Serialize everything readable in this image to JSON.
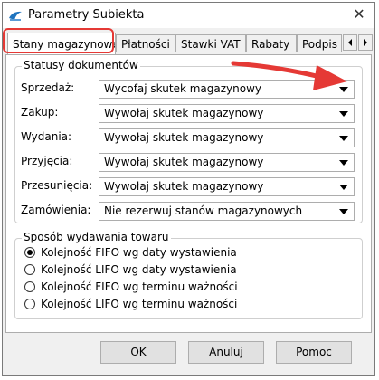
{
  "window": {
    "title": "Parametry Subiekta",
    "close_glyph": "✕"
  },
  "tabs": [
    {
      "label": "Stany magazynowe",
      "active": true
    },
    {
      "label": "Płatności"
    },
    {
      "label": "Stawki VAT"
    },
    {
      "label": "Rabaty"
    },
    {
      "label": "Podpis e"
    }
  ],
  "document_status": {
    "title": "Statusy dokumentów",
    "rows": [
      {
        "label": "Sprzedaż:",
        "value": "Wycofaj skutek magazynowy"
      },
      {
        "label": "Zakup:",
        "value": "Wywołaj skutek magazynowy"
      },
      {
        "label": "Wydania:",
        "value": "Wywołaj skutek magazynowy"
      },
      {
        "label": "Przyjęcia:",
        "value": "Wywołaj skutek magazynowy"
      },
      {
        "label": "Przesunięcia:",
        "value": "Wywołaj skutek magazynowy"
      },
      {
        "label": "Zamówienia:",
        "value": "Nie rezerwuj stanów magazynowych"
      }
    ]
  },
  "issue_method": {
    "title": "Sposób wydawania towaru",
    "options": [
      {
        "label": "Kolejność FIFO wg daty wystawienia",
        "checked": true
      },
      {
        "label": "Kolejność LIFO wg daty wystawienia",
        "checked": false
      },
      {
        "label": "Kolejność FIFO wg terminu ważności",
        "checked": false
      },
      {
        "label": "Kolejność LIFO wg terminu ważności",
        "checked": false
      }
    ]
  },
  "buttons": {
    "ok": "OK",
    "cancel": "Anuluj",
    "help": "Pomoc"
  },
  "colors": {
    "annotation": "#e53935",
    "accent": "#1e73be"
  }
}
